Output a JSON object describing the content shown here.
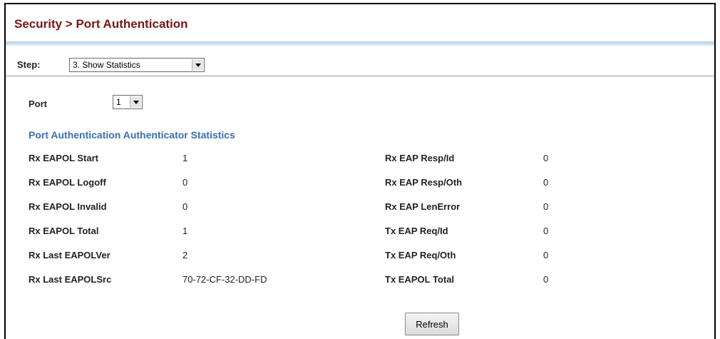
{
  "header": {
    "title": "Security > Port Authentication"
  },
  "step": {
    "label": "Step:",
    "selected": "3. Show Statistics"
  },
  "port": {
    "label": "Port",
    "selected": "1"
  },
  "section_title": "Port Authentication Authenticator Statistics",
  "stats": {
    "left": [
      {
        "label": "Rx EAPOL Start",
        "value": "1"
      },
      {
        "label": "Rx EAPOL Logoff",
        "value": "0"
      },
      {
        "label": "Rx EAPOL Invalid",
        "value": "0"
      },
      {
        "label": "Rx EAPOL Total",
        "value": "1"
      },
      {
        "label": "Rx Last EAPOLVer",
        "value": "2"
      },
      {
        "label": "Rx Last EAPOLSrc",
        "value": "70-72-CF-32-DD-FD"
      }
    ],
    "right": [
      {
        "label": "Rx EAP Resp/Id",
        "value": "0"
      },
      {
        "label": "Rx EAP Resp/Oth",
        "value": "0"
      },
      {
        "label": "Rx EAP LenError",
        "value": "0"
      },
      {
        "label": "Tx EAP Req/Id",
        "value": "0"
      },
      {
        "label": "Tx EAP Req/Oth",
        "value": "0"
      },
      {
        "label": "Tx EAPOL Total",
        "value": "0"
      }
    ]
  },
  "actions": {
    "refresh_label": "Refresh"
  },
  "colors": {
    "title": "#7a1515",
    "section": "#3a6fb0",
    "rule": "#b7cde6"
  }
}
